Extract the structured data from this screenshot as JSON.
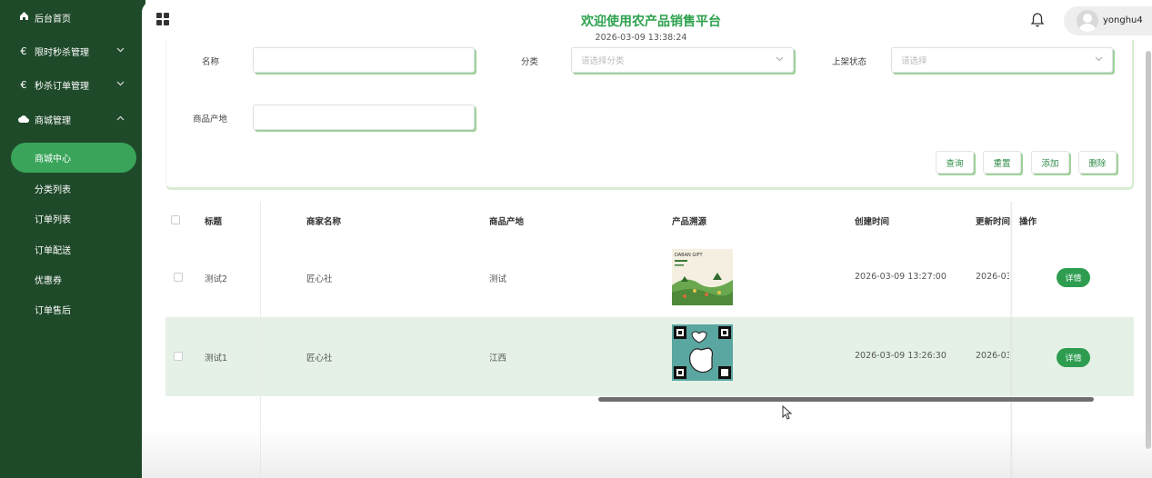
{
  "sidebar": {
    "items": [
      {
        "icon": "home-icon",
        "label": "后台首页"
      },
      {
        "icon": "euro-icon",
        "label": "限时秒杀管理"
      },
      {
        "icon": "euro-icon",
        "label": "秒杀订单管理"
      },
      {
        "icon": "cloud-icon",
        "label": "商城管理"
      }
    ],
    "sub_items": [
      "商城中心",
      "分类列表",
      "订单列表",
      "订单配送",
      "优惠券",
      "订单售后"
    ],
    "active": "商城中心"
  },
  "header": {
    "title": "欢迎使用农产品销售平台",
    "datetime": "2026-03-09 13:38:24",
    "username": "yonghu4"
  },
  "search": {
    "name_label": "名称",
    "category_label": "分类",
    "category_placeholder": "请选择分类",
    "status_label": "上架状态",
    "status_placeholder": "请选择",
    "origin_label": "商品产地",
    "buttons": {
      "query": "查询",
      "reset": "重置",
      "add": "添加",
      "delete": "删除"
    }
  },
  "table": {
    "headers": [
      "标题",
      "商家名称",
      "商品产地",
      "产品溯源",
      "创建时间",
      "更新时间",
      "操作"
    ],
    "rows": [
      {
        "title": "测试2",
        "merchant": "匠心社",
        "origin": "测试",
        "created": "2026-03-09 13:27:00",
        "updated": "2026-03-0",
        "action": "详情",
        "img_text": "DABAN GIFT"
      },
      {
        "title": "测试1",
        "merchant": "匠心社",
        "origin": "江西",
        "created": "2026-03-09 13:26:30",
        "updated": "2026-03-0",
        "action": "详情"
      }
    ]
  },
  "colors": {
    "sidebar_bg": "#1f4a2a",
    "accent": "#2da24e",
    "active_item": "#3aa55a",
    "row_highlight": "#e5f1e7"
  }
}
